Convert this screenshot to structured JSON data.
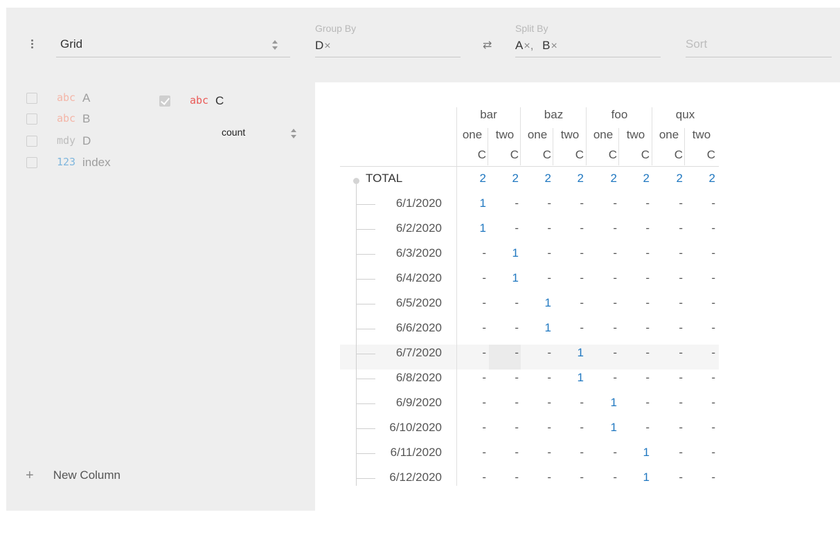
{
  "toolbar": {
    "plugin": "Grid",
    "group_by": {
      "label": "Group By",
      "items": [
        "D"
      ]
    },
    "split_by": {
      "label": "Split By",
      "items": [
        "A",
        "B"
      ]
    },
    "sort": {
      "placeholder": "Sort"
    },
    "remove_glyph": "×",
    "swap_glyph": "⇄"
  },
  "columns": [
    {
      "type": "abc",
      "name": "A",
      "active": false,
      "type_color": "#f4b6a8"
    },
    {
      "type": "abc",
      "name": "B",
      "active": false,
      "type_color": "#f4b6a8"
    },
    {
      "type": "mdy",
      "name": "D",
      "active": false,
      "type_color": "#bdbdbd"
    },
    {
      "type": "123",
      "name": "index",
      "active": false,
      "type_color": "#7fb6dd"
    }
  ],
  "active_column": {
    "type": "abc",
    "name": "C",
    "aggregate": "count",
    "type_color": "#ea5a57"
  },
  "new_column": {
    "label": "New Column",
    "icon": "+"
  },
  "grid": {
    "split_top": [
      "bar",
      "baz",
      "foo",
      "qux"
    ],
    "split_sub": [
      "one",
      "two",
      "one",
      "two",
      "one",
      "two",
      "one",
      "two"
    ],
    "column_name": "C",
    "total": {
      "label": "TOTAL",
      "values": [
        "2",
        "2",
        "2",
        "2",
        "2",
        "2",
        "2",
        "2"
      ]
    },
    "rows": [
      {
        "label": "6/1/2020",
        "values": [
          "1",
          "-",
          "-",
          "-",
          "-",
          "-",
          "-",
          "-"
        ]
      },
      {
        "label": "6/2/2020",
        "values": [
          "1",
          "-",
          "-",
          "-",
          "-",
          "-",
          "-",
          "-"
        ]
      },
      {
        "label": "6/3/2020",
        "values": [
          "-",
          "1",
          "-",
          "-",
          "-",
          "-",
          "-",
          "-"
        ]
      },
      {
        "label": "6/4/2020",
        "values": [
          "-",
          "1",
          "-",
          "-",
          "-",
          "-",
          "-",
          "-"
        ]
      },
      {
        "label": "6/5/2020",
        "values": [
          "-",
          "-",
          "1",
          "-",
          "-",
          "-",
          "-",
          "-"
        ]
      },
      {
        "label": "6/6/2020",
        "values": [
          "-",
          "-",
          "1",
          "-",
          "-",
          "-",
          "-",
          "-"
        ]
      },
      {
        "label": "6/7/2020",
        "values": [
          "-",
          "-",
          "-",
          "1",
          "-",
          "-",
          "-",
          "-"
        ]
      },
      {
        "label": "6/8/2020",
        "values": [
          "-",
          "-",
          "-",
          "1",
          "-",
          "-",
          "-",
          "-"
        ]
      },
      {
        "label": "6/9/2020",
        "values": [
          "-",
          "-",
          "-",
          "-",
          "1",
          "-",
          "-",
          "-"
        ]
      },
      {
        "label": "6/10/2020",
        "values": [
          "-",
          "-",
          "-",
          "-",
          "1",
          "-",
          "-",
          "-"
        ]
      },
      {
        "label": "6/11/2020",
        "values": [
          "-",
          "-",
          "-",
          "-",
          "-",
          "1",
          "-",
          "-"
        ]
      },
      {
        "label": "6/12/2020",
        "values": [
          "-",
          "-",
          "-",
          "-",
          "-",
          "1",
          "-",
          "-"
        ]
      }
    ],
    "hover_row": 6,
    "hover_col": 1,
    "value_color": "#1f77c0"
  }
}
